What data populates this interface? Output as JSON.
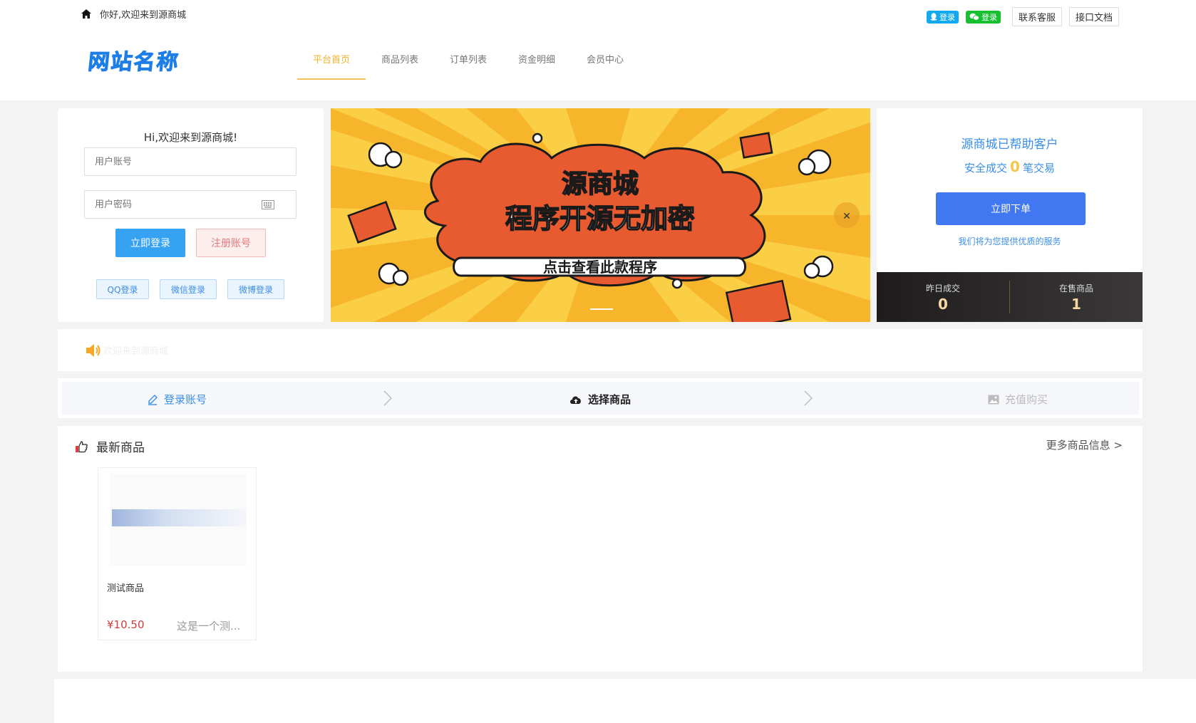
{
  "topbar": {
    "greeting": "你好,欢迎来到源商城",
    "qq_login": "登录",
    "wechat_login": "登录",
    "contact": "联系客服",
    "api_doc": "接口文档"
  },
  "logo": "网站名称",
  "nav": {
    "items": [
      {
        "label": "平台首页",
        "active": true
      },
      {
        "label": "商品列表"
      },
      {
        "label": "订单列表"
      },
      {
        "label": "资金明细"
      },
      {
        "label": "会员中心"
      }
    ]
  },
  "login": {
    "title": "Hi,欢迎来到源商城!",
    "username_placeholder": "用户账号",
    "password_placeholder": "用户密码",
    "login_button": "立即登录",
    "register_button": "注册账号",
    "social": [
      "QQ登录",
      "微信登录",
      "微博登录"
    ]
  },
  "banner": {
    "headline": "源商城",
    "subheadline": "程序开源无加密",
    "cta": "点击查看此款程序"
  },
  "stats": {
    "title": "源商城已帮助客户",
    "line_prefix": "安全成交",
    "count": "0",
    "line_suffix": "笔交易",
    "order_button": "立即下单",
    "note": "我们将为您提供优质的服务",
    "yesterday_label": "昨日成交",
    "yesterday_value": "0",
    "onsale_label": "在售商品",
    "onsale_value": "1"
  },
  "notice": {
    "text": "欢迎来到源商城"
  },
  "steps": {
    "items": [
      "登录账号",
      "选择商品",
      "充值购买"
    ],
    "active_index": 1
  },
  "products": {
    "title": "最新商品",
    "more": "更多商品信息 >",
    "items": [
      {
        "name": "测试商品",
        "price": "¥10.50",
        "desc": "这是一个测..."
      }
    ]
  },
  "colors": {
    "accent_blue": "#4178f2",
    "nav_active": "#f2b22b",
    "price_red": "#d23b3b"
  }
}
